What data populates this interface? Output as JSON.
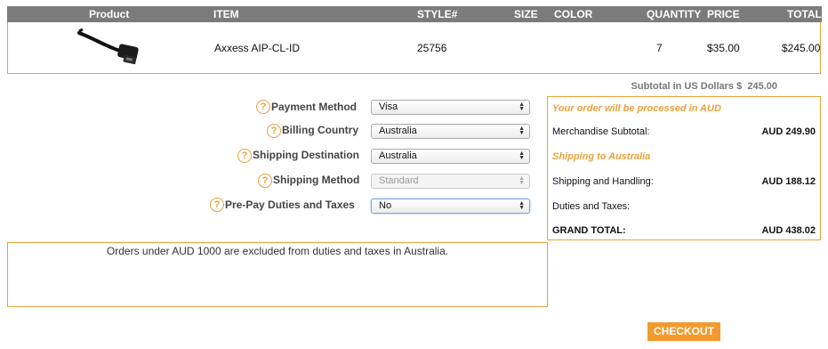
{
  "cart": {
    "headers": {
      "product": "Product",
      "item": "ITEM",
      "style": "STYLE#",
      "size": "SIZE",
      "color": "COLOR",
      "quantity": "QUANTITY",
      "price": "PRICE",
      "total": "TOTAL"
    },
    "row": {
      "item": "Axxess AIP-CL-ID",
      "style": "25756",
      "size": "",
      "color": "",
      "quantity": "7",
      "price": "$35.00",
      "total": "$245.00"
    },
    "subtotal_label": "Subtotal in US Dollars $",
    "subtotal_value": "245.00"
  },
  "form": {
    "payment_method": {
      "label": "Payment Method",
      "value": "Visa"
    },
    "billing_country": {
      "label": "Billing Country",
      "value": "Australia"
    },
    "shipping_destination": {
      "label": "Shipping Destination",
      "value": "Australia"
    },
    "shipping_method": {
      "label": "Shipping Method",
      "value": "Standard"
    },
    "prepay_duties": {
      "label": "Pre-Pay Duties and Taxes",
      "value": "No"
    },
    "help_glyph": "?"
  },
  "summary": {
    "currency_note": "Your order will be processed in AUD",
    "merch_label": "Merchandise Subtotal:",
    "merch_value": "AUD 249.90",
    "shipping_note": "Shipping to Australia",
    "shipping_label": "Shipping and Handling:",
    "shipping_value": "AUD 188.12",
    "duties_label": "Duties and Taxes:",
    "duties_value": "",
    "grand_label": "GRAND TOTAL:",
    "grand_value": "AUD 438.02"
  },
  "notice": "Orders under AUD 1000 are excluded from duties and taxes in Australia.",
  "checkout": {
    "label": "CHECKOUT"
  },
  "colors": {
    "accent": "#e8a13a",
    "header": "#7b7b7b",
    "checkout": "#f39a2e"
  }
}
